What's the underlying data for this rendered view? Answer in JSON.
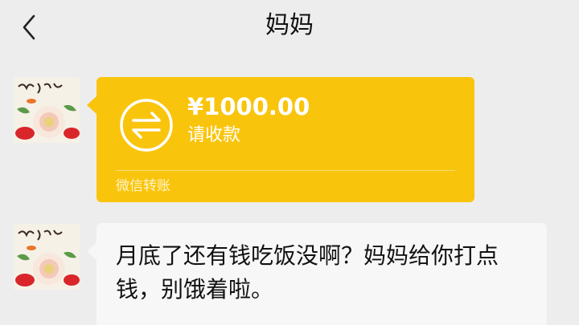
{
  "header": {
    "title": "妈妈",
    "back_icon": "chevron-left-icon"
  },
  "messages": [
    {
      "type": "transfer",
      "amount": "¥1000.00",
      "status": "请收款",
      "source": "微信转账",
      "icon": "transfer-arrows-icon",
      "color": "#f9c40c"
    },
    {
      "type": "text",
      "text": "月底了还有钱吃饭没啊？妈妈给你打点钱，别饿着啦。"
    }
  ],
  "colors": {
    "background": "#ededed",
    "transfer_bubble": "#f9c40c",
    "text_bubble": "#f7f7f7"
  }
}
